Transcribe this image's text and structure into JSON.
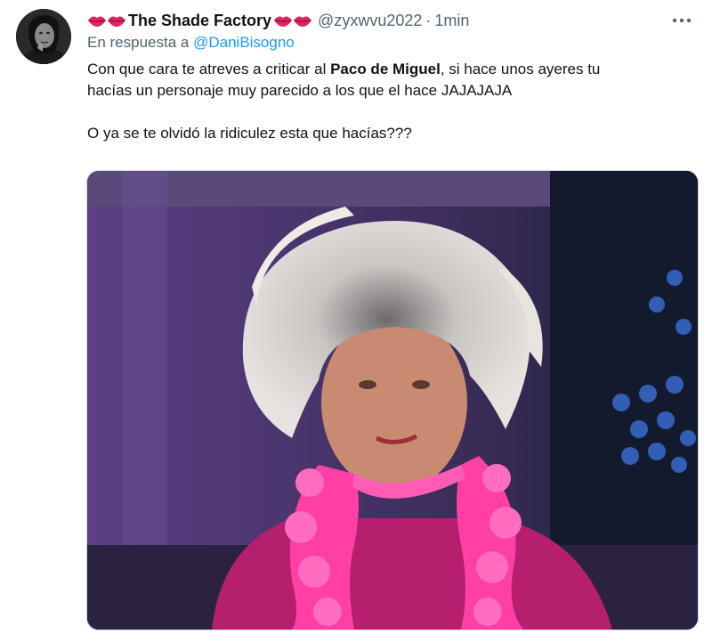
{
  "tweet": {
    "display_name": "The Shade Factory",
    "handle": "@zyxwvu2022",
    "separator": "·",
    "time": "1min",
    "reply_prefix": "En respuesta a",
    "reply_mention": "@DaniBisogno",
    "text_line1_a": "Con que cara te atreves a criticar al ",
    "text_line1_bold": "Paco de Miguel",
    "text_line1_b": ", si hace unos ayeres tu",
    "text_line2": "hacías un personaje muy parecido a los que el hace JAJAJAJA",
    "text_line3": "O ya se te olvidó la ridiculez esta que hacías???"
  },
  "icons": {
    "name_emoji": "kiss-mark-icon",
    "more": "more-horizontal-icon"
  },
  "colors": {
    "text_primary": "#0f1419",
    "text_secondary": "#536471",
    "link": "#1d9bf0",
    "lips": "#e0245e",
    "border": "#cfd9de"
  }
}
